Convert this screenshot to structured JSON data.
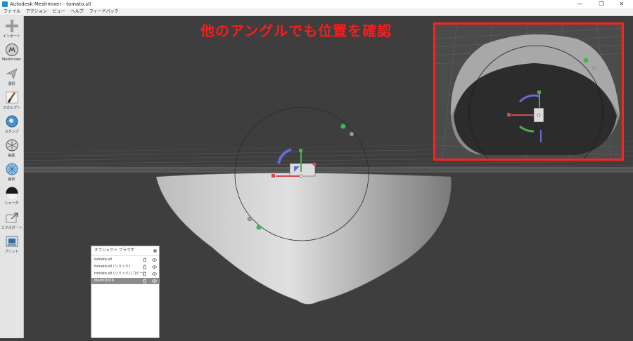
{
  "window": {
    "title": "Autodesk Meshmixer - tomato.stl",
    "minimize": "—",
    "maximize": "❐",
    "close": "✕"
  },
  "menu": [
    "ファイル",
    "アクション",
    "ビュー",
    "ヘルプ",
    "フィードバック"
  ],
  "tools": [
    {
      "label": "インポート",
      "icon": "plus-icon"
    },
    {
      "label": "Meshmixer",
      "icon": "meshmixer-icon"
    },
    {
      "label": "選択",
      "icon": "select-arrow-icon"
    },
    {
      "label": "スカルプト",
      "icon": "brush-icon"
    },
    {
      "label": "スタンプ",
      "icon": "stamp-icon"
    },
    {
      "label": "編集",
      "icon": "edit-icon"
    },
    {
      "label": "解析",
      "icon": "analysis-icon"
    },
    {
      "label": "シェーダ",
      "icon": "shader-sphere-icon"
    },
    {
      "label": "エクスポート",
      "icon": "export-icon"
    },
    {
      "label": "プリント",
      "icon": "print-icon"
    }
  ],
  "annotation": "他のアングルでも位置を確認",
  "object_browser": {
    "title": "オブジェクト ブラウザ",
    "items": [
      {
        "name": "tomato.stl",
        "selected": false
      },
      {
        "name": "tomato.stl (ソリッド)",
        "selected": false
      },
      {
        "name": "tomato.stl (ソリッド) (コピー)",
        "selected": false
      },
      {
        "name": "MeshID016",
        "selected": true
      }
    ]
  },
  "colors": {
    "viewport_bg": "#3e3e3e",
    "annotation": "#ff1a1a",
    "gizmo_x": "#d04a4a",
    "gizmo_y": "#48b048",
    "gizmo_z": "#6666dd"
  }
}
